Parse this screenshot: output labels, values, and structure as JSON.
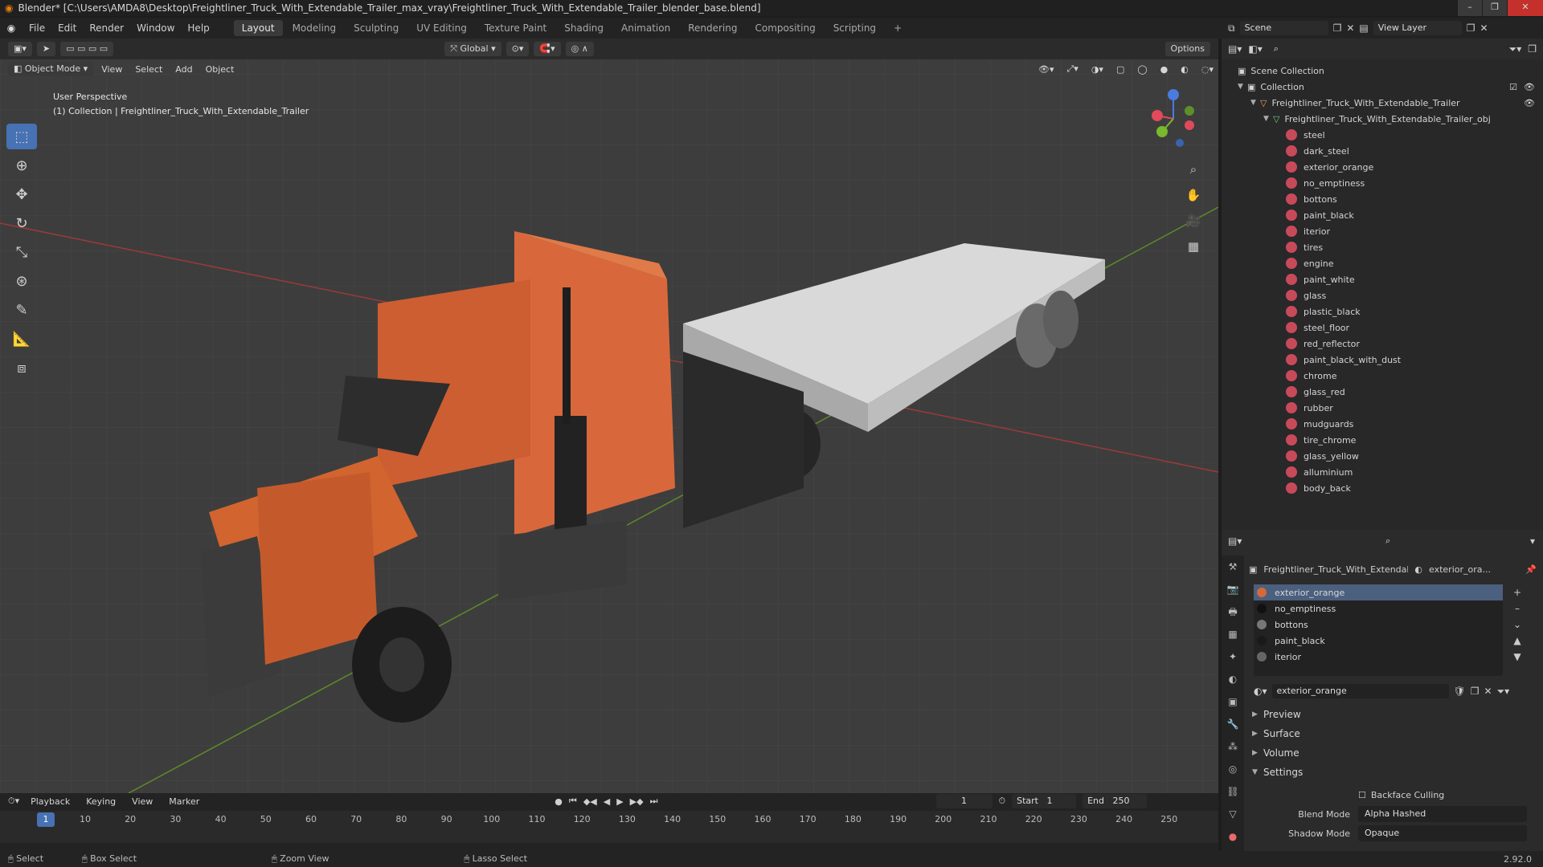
{
  "title": "Blender* [C:\\Users\\AMDA8\\Desktop\\Freightliner_Truck_With_Extendable_Trailer_max_vray\\Freightliner_Truck_With_Extendable_Trailer_blender_base.blend]",
  "menu": [
    "File",
    "Edit",
    "Render",
    "Window",
    "Help"
  ],
  "workspaces": [
    "Layout",
    "Modeling",
    "Sculpting",
    "UV Editing",
    "Texture Paint",
    "Shading",
    "Animation",
    "Rendering",
    "Compositing",
    "Scripting"
  ],
  "active_workspace": "Layout",
  "scene": {
    "label": "Scene",
    "view_layer": "View Layer"
  },
  "viewport": {
    "transform": "Global",
    "options": "Options",
    "mode": "Object Mode",
    "menu": [
      "View",
      "Select",
      "Add",
      "Object"
    ],
    "perspective": "User Perspective",
    "collection_info": "(1) Collection | Freightliner_Truck_With_Extendable_Trailer"
  },
  "outliner": {
    "scene_collection": "Scene Collection",
    "collection": "Collection",
    "object": "Freightliner_Truck_With_Extendable_Trailer",
    "mesh": "Freightliner_Truck_With_Extendable_Trailer_obj",
    "materials": [
      "steel",
      "dark_steel",
      "exterior_orange",
      "no_emptiness",
      "bottons",
      "paint_black",
      "iterior",
      "tires",
      "engine",
      "paint_white",
      "glass",
      "plastic_black",
      "steel_floor",
      "red_reflector",
      "paint_black_with_dust",
      "chrome",
      "glass_red",
      "rubber",
      "mudguards",
      "tire_chrome",
      "glass_yellow",
      "alluminium",
      "body_back"
    ]
  },
  "properties": {
    "object_name": "Freightliner_Truck_With_Extendabl...",
    "material_name": "exterior_ora...",
    "slots": [
      "exterior_orange",
      "no_emptiness",
      "bottons",
      "paint_black",
      "iterior"
    ],
    "active_material": "exterior_orange",
    "sections": [
      "Preview",
      "Surface",
      "Volume",
      "Settings"
    ],
    "backface_culling": "Backface Culling",
    "blend_mode_label": "Blend Mode",
    "blend_mode": "Alpha Hashed",
    "shadow_mode_label": "Shadow Mode",
    "shadow_mode": "Opaque"
  },
  "timeline": {
    "menu": [
      "Playback",
      "Keying",
      "View",
      "Marker"
    ],
    "current_frame": "1",
    "start_label": "Start",
    "start": "1",
    "end_label": "End",
    "end": "250",
    "ticks": [
      "10",
      "20",
      "30",
      "40",
      "50",
      "60",
      "70",
      "80",
      "90",
      "100",
      "110",
      "120",
      "130",
      "140",
      "150",
      "160",
      "170",
      "180",
      "190",
      "200",
      "210",
      "220",
      "230",
      "240",
      "250"
    ],
    "playhead": "1"
  },
  "status": {
    "select": "Select",
    "box_select": "Box Select",
    "zoom_view": "Zoom View",
    "lasso_select": "Lasso Select",
    "version": "2.92.0"
  }
}
